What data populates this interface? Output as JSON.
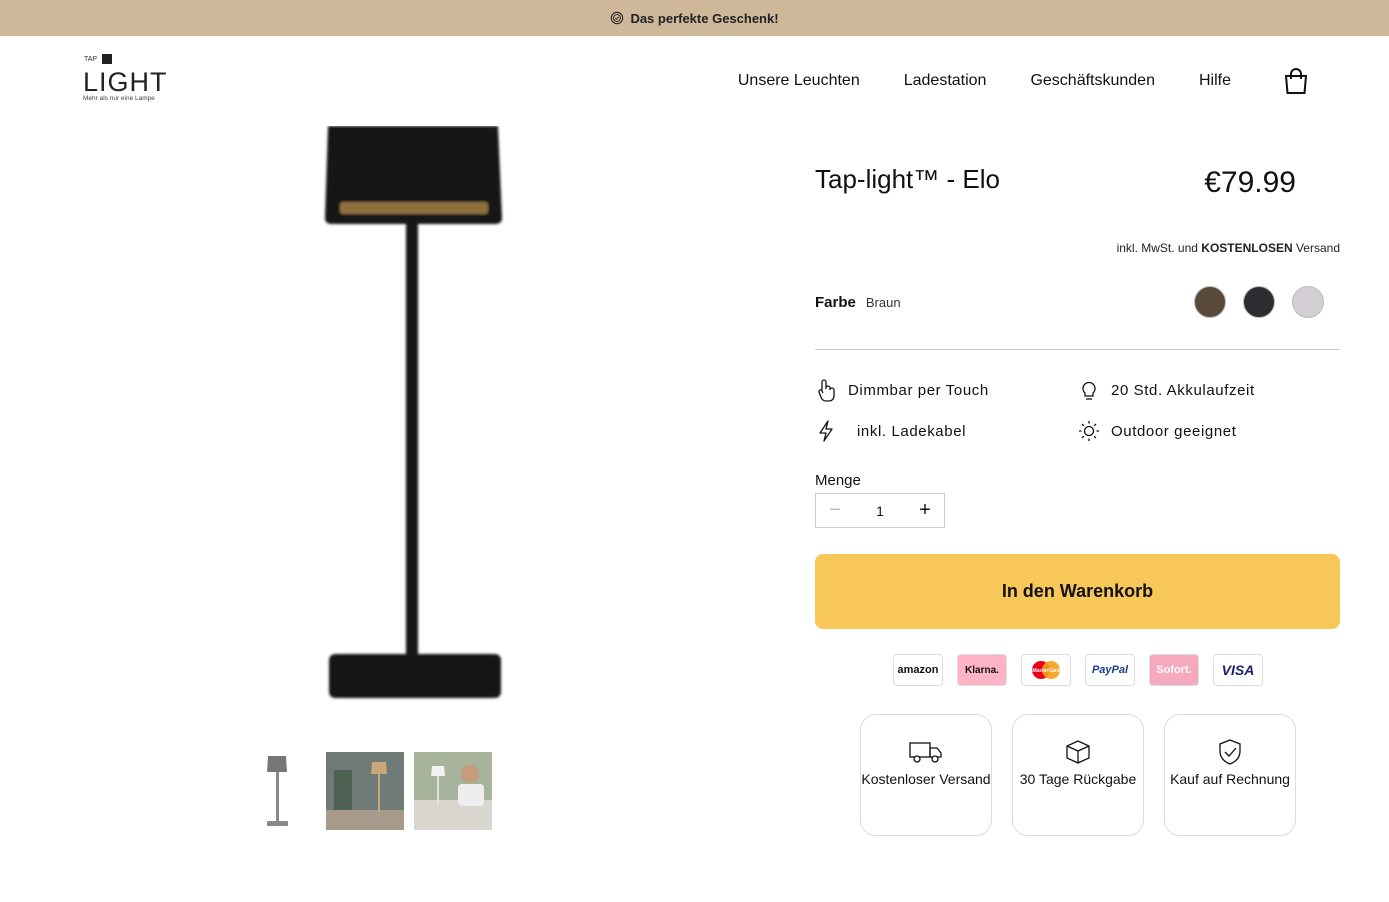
{
  "announcement": {
    "text": "Das perfekte Geschenk!"
  },
  "logo": {
    "small": "TAP",
    "main": "LIGHT",
    "tagline": "Mehr als nur eine Lampe"
  },
  "nav": {
    "items": [
      "Unsere Leuchten",
      "Ladestation",
      "Geschäftskunden",
      "Hilfe"
    ]
  },
  "product": {
    "title": "Tap-light™ - Elo",
    "price": "€79.99",
    "tax_prefix": "inkl. MwSt. und ",
    "tax_bold": "KOSTENLOSEN",
    "tax_suffix": " Versand",
    "color_label": "Farbe",
    "color_value": "Braun",
    "swatches": [
      "#5a4a3a",
      "#2b2d31",
      "#d4cfd4"
    ],
    "features": [
      "Dimmbar per Touch",
      "20 Std. Akkulaufzeit",
      "inkl. Ladekabel",
      "Outdoor geeignet"
    ],
    "quantity_label": "Menge",
    "quantity": "1",
    "add_to_cart": "In den Warenkorb"
  },
  "payments": [
    "amazon",
    "Klarna.",
    "MasterCard",
    "PayPal",
    "Sofort.",
    "VISA"
  ],
  "trust": [
    "Kostenloser Versand",
    "30 Tage Rückgabe",
    "Kauf auf Rechnung"
  ],
  "colors": {
    "announcement_bg": "#cfb899",
    "cta": "#f7c75a",
    "klarna": "#ffb3c7",
    "sofort": "#f5a9bf"
  }
}
